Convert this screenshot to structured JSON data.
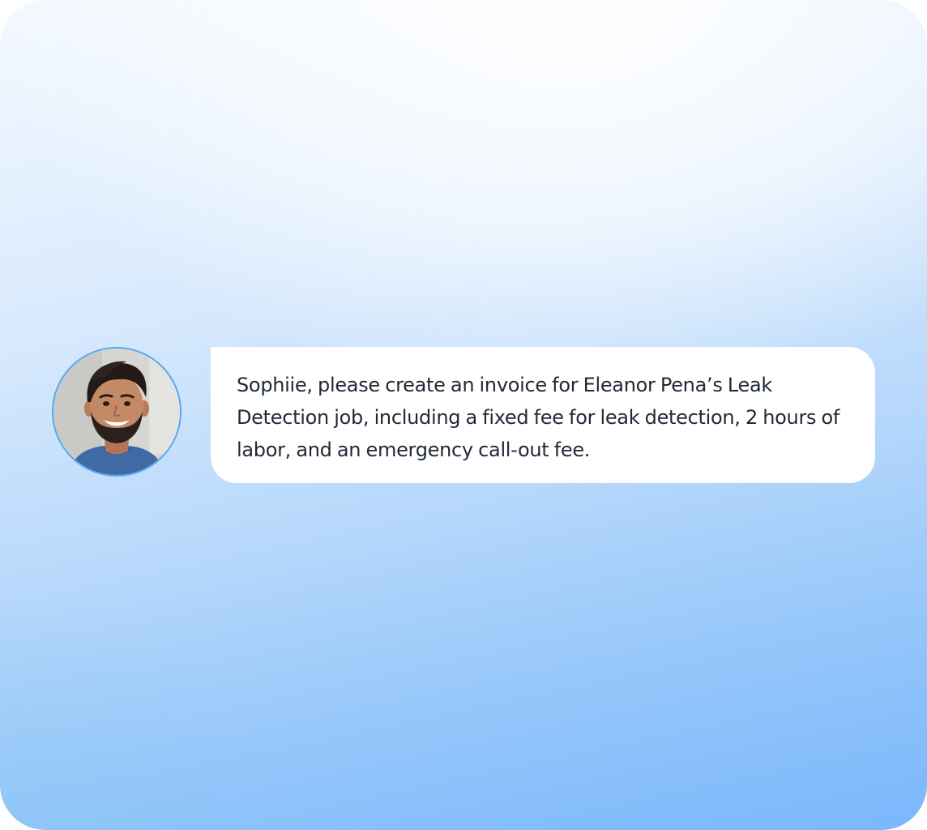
{
  "chat": {
    "message": {
      "text": "Sophiie, please create an invoice for Eleanor Pena’s Leak Detection job, including a fixed fee for leak detection, 2 hours of labor, and an emergency call-out fee."
    },
    "avatar": {
      "icon": "user-photo"
    }
  },
  "colors": {
    "accent_border": "#54a8f0",
    "bubble_bg": "#ffffff",
    "text": "#1f2937"
  }
}
